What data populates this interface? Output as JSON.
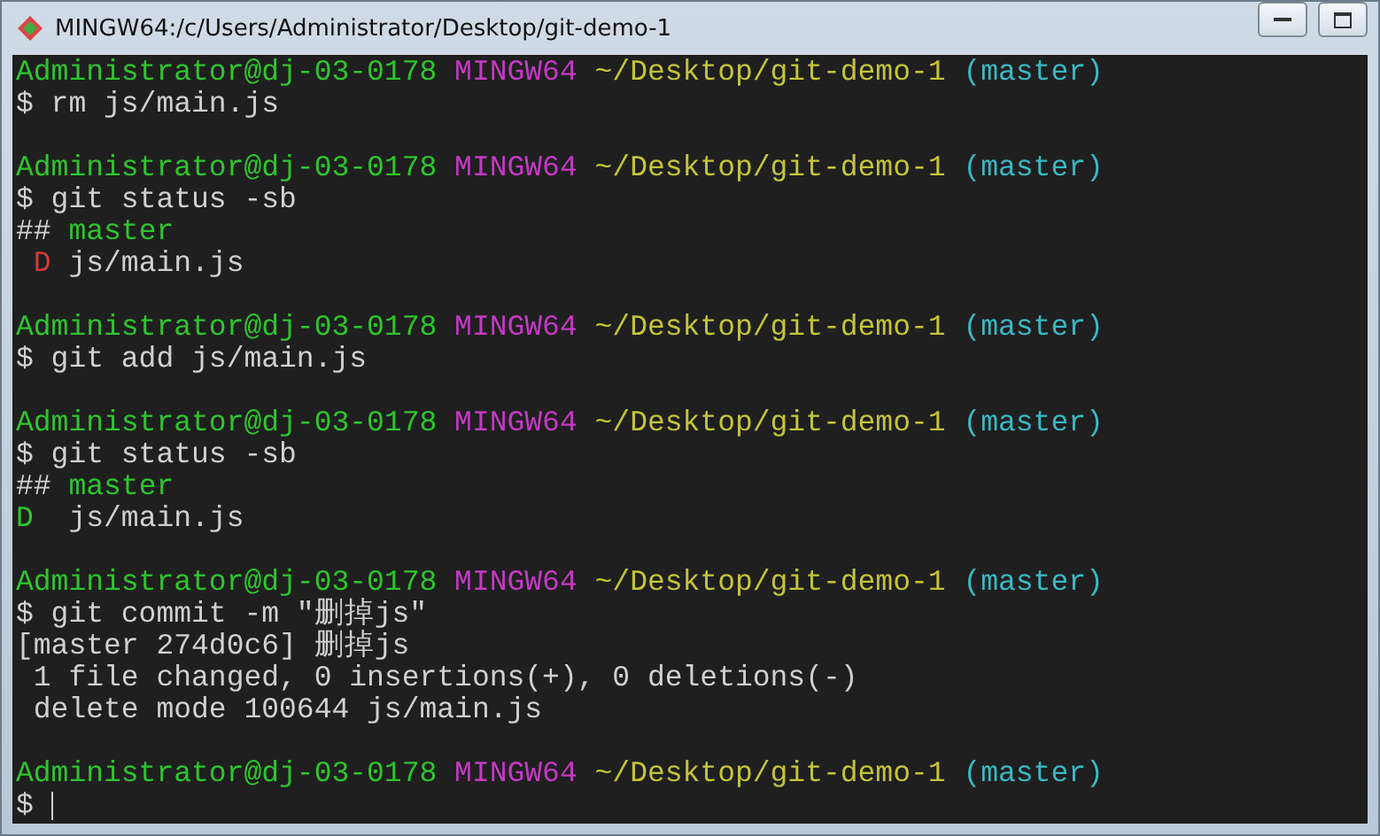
{
  "window": {
    "title": "MINGW64:/c/Users/Administrator/Desktop/git-demo-1"
  },
  "lines": [
    {
      "kind": "text",
      "segments": [
        {
          "text": "Administrator@dj-03-0178",
          "color": "#2ec52e"
        },
        {
          "text": " MINGW64",
          "color": "#c43ac4"
        },
        {
          "text": " ~/Desktop/git-demo-1",
          "color": "#c4c43a"
        },
        {
          "text": " (master)",
          "color": "#3ab8c4"
        }
      ]
    },
    {
      "kind": "text",
      "segments": [
        {
          "text": "$ rm js/main.js",
          "color": "#d0d0d0"
        }
      ]
    },
    {
      "kind": "blank"
    },
    {
      "kind": "text",
      "segments": [
        {
          "text": "Administrator@dj-03-0178",
          "color": "#2ec52e"
        },
        {
          "text": " MINGW64",
          "color": "#c43ac4"
        },
        {
          "text": " ~/Desktop/git-demo-1",
          "color": "#c4c43a"
        },
        {
          "text": " (master)",
          "color": "#3ab8c4"
        }
      ]
    },
    {
      "kind": "text",
      "segments": [
        {
          "text": "$ git status -sb",
          "color": "#d0d0d0"
        }
      ]
    },
    {
      "kind": "text",
      "segments": [
        {
          "text": "## ",
          "color": "#d0d0d0"
        },
        {
          "text": "master",
          "color": "#2ec52e"
        }
      ]
    },
    {
      "kind": "text",
      "segments": [
        {
          "text": " D",
          "color": "#d03a3a"
        },
        {
          "text": " js/main.js",
          "color": "#d0d0d0"
        }
      ]
    },
    {
      "kind": "blank"
    },
    {
      "kind": "text",
      "segments": [
        {
          "text": "Administrator@dj-03-0178",
          "color": "#2ec52e"
        },
        {
          "text": " MINGW64",
          "color": "#c43ac4"
        },
        {
          "text": " ~/Desktop/git-demo-1",
          "color": "#c4c43a"
        },
        {
          "text": " (master)",
          "color": "#3ab8c4"
        }
      ]
    },
    {
      "kind": "text",
      "segments": [
        {
          "text": "$ git add js/main.js",
          "color": "#d0d0d0"
        }
      ]
    },
    {
      "kind": "blank"
    },
    {
      "kind": "text",
      "segments": [
        {
          "text": "Administrator@dj-03-0178",
          "color": "#2ec52e"
        },
        {
          "text": " MINGW64",
          "color": "#c43ac4"
        },
        {
          "text": " ~/Desktop/git-demo-1",
          "color": "#c4c43a"
        },
        {
          "text": " (master)",
          "color": "#3ab8c4"
        }
      ]
    },
    {
      "kind": "text",
      "segments": [
        {
          "text": "$ git status -sb",
          "color": "#d0d0d0"
        }
      ]
    },
    {
      "kind": "text",
      "segments": [
        {
          "text": "## ",
          "color": "#d0d0d0"
        },
        {
          "text": "master",
          "color": "#2ec52e"
        }
      ]
    },
    {
      "kind": "text",
      "segments": [
        {
          "text": "D",
          "color": "#2ec52e"
        },
        {
          "text": "  js/main.js",
          "color": "#d0d0d0"
        }
      ]
    },
    {
      "kind": "blank"
    },
    {
      "kind": "text",
      "segments": [
        {
          "text": "Administrator@dj-03-0178",
          "color": "#2ec52e"
        },
        {
          "text": " MINGW64",
          "color": "#c43ac4"
        },
        {
          "text": " ~/Desktop/git-demo-1",
          "color": "#c4c43a"
        },
        {
          "text": " (master)",
          "color": "#3ab8c4"
        }
      ]
    },
    {
      "kind": "text",
      "segments": [
        {
          "text": "$ git commit -m \"删掉js\"",
          "color": "#d0d0d0"
        }
      ]
    },
    {
      "kind": "text",
      "segments": [
        {
          "text": "[master 274d0c6] 删掉js",
          "color": "#d0d0d0"
        }
      ]
    },
    {
      "kind": "text",
      "segments": [
        {
          "text": " 1 file changed, 0 insertions(+), 0 deletions(-)",
          "color": "#d0d0d0"
        }
      ]
    },
    {
      "kind": "text",
      "segments": [
        {
          "text": " delete mode 100644 js/main.js",
          "color": "#d0d0d0"
        }
      ]
    },
    {
      "kind": "blank"
    },
    {
      "kind": "text",
      "segments": [
        {
          "text": "Administrator@dj-03-0178",
          "color": "#2ec52e"
        },
        {
          "text": " MINGW64",
          "color": "#c43ac4"
        },
        {
          "text": " ~/Desktop/git-demo-1",
          "color": "#c4c43a"
        },
        {
          "text": " (master)",
          "color": "#3ab8c4"
        }
      ]
    },
    {
      "kind": "input",
      "segments": [
        {
          "text": "$",
          "color": "#d0d0d0"
        }
      ]
    }
  ]
}
